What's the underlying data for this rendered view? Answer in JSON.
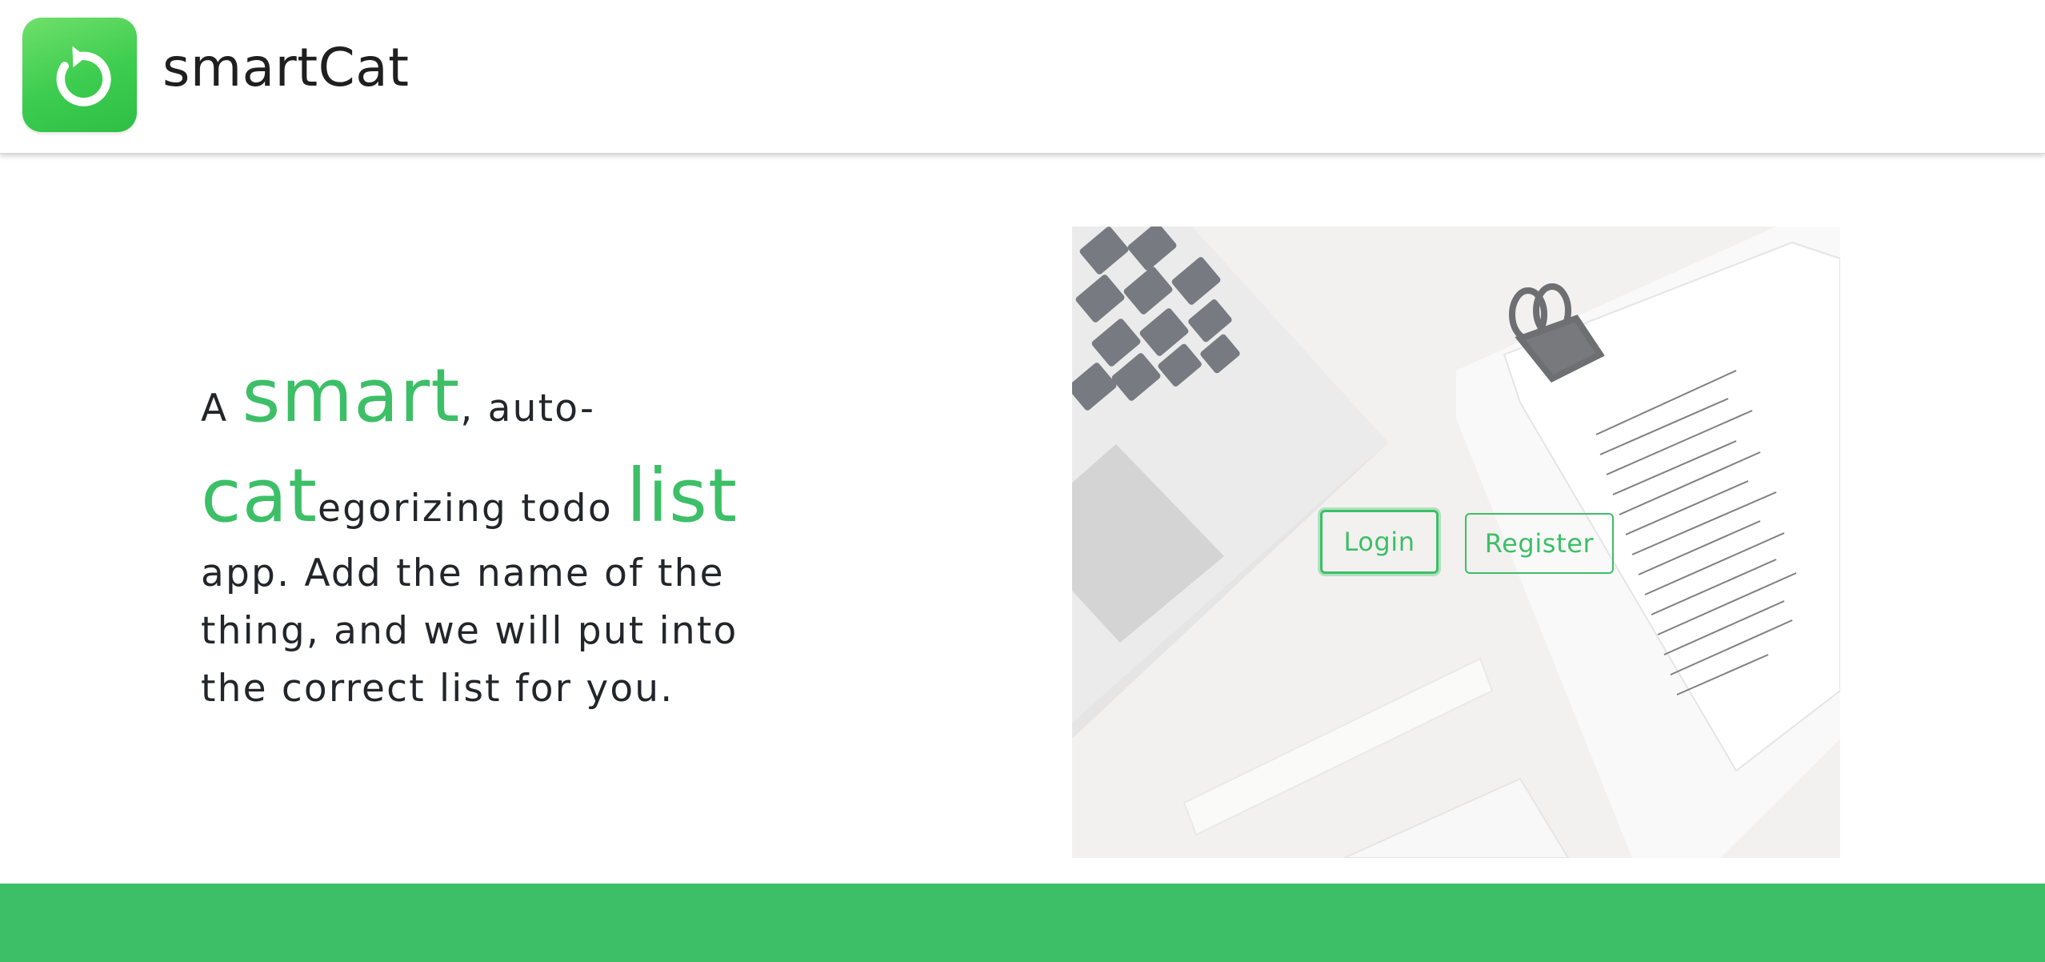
{
  "app": {
    "name": "smartCat",
    "logo_icon": "refresh-arrow-icon",
    "brand_color": "#3cbf67"
  },
  "hero": {
    "w1": "A ",
    "w2": "smart",
    "w3": ", auto-",
    "w4": "cat",
    "w5": "egorizing todo ",
    "w6": "list",
    "rest": "app. Add the name of the thing, and we will put into the correct list for you."
  },
  "auth": {
    "login_label": "Login",
    "register_label": "Register"
  }
}
